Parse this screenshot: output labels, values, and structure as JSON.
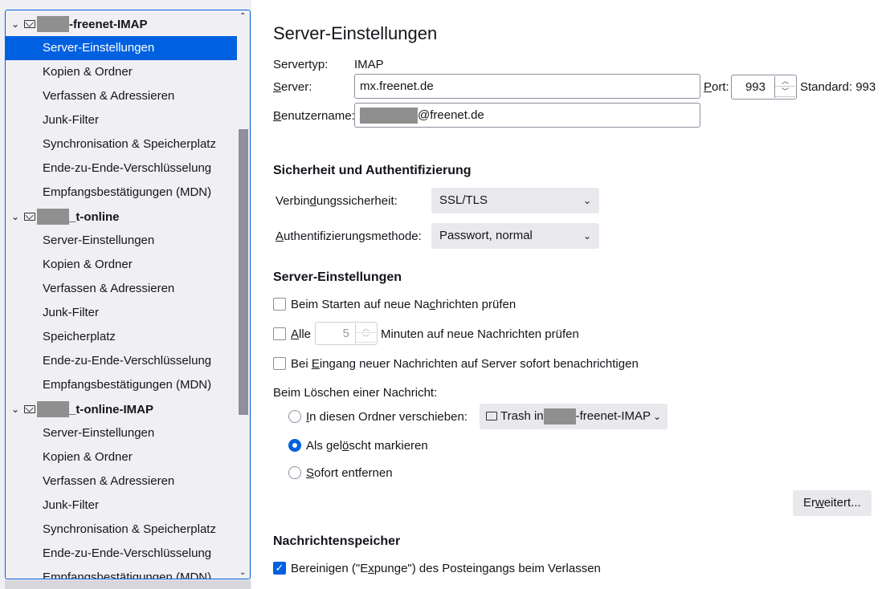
{
  "tree": {
    "accounts": [
      {
        "name_suffix": "-freenet-IMAP",
        "items": [
          "Server-Einstellungen",
          "Kopien & Ordner",
          "Verfassen & Adressieren",
          "Junk-Filter",
          "Synchronisation & Speicherplatz",
          "Ende-zu-Ende-Verschlüsselung",
          "Empfangsbestätigungen (MDN)"
        ]
      },
      {
        "name_suffix": "_t-online",
        "items": [
          "Server-Einstellungen",
          "Kopien & Ordner",
          "Verfassen & Adressieren",
          "Junk-Filter",
          "Speicherplatz",
          "Ende-zu-Ende-Verschlüsselung",
          "Empfangsbestätigungen (MDN)"
        ]
      },
      {
        "name_suffix": "_t-online-IMAP",
        "items": [
          "Server-Einstellungen",
          "Kopien & Ordner",
          "Verfassen & Adressieren",
          "Junk-Filter",
          "Synchronisation & Speicherplatz",
          "Ende-zu-Ende-Verschlüsselung",
          "Empfangsbestätigungen (MDN)"
        ]
      }
    ],
    "selected": "Server-Einstellungen"
  },
  "page": {
    "title": "Server-Einstellungen",
    "servertyp_label": "Servertyp:",
    "servertyp_value": "IMAP",
    "server_label": "Server:",
    "server_value": "mx.freenet.de",
    "port_label": "Port:",
    "port_value": "993",
    "standard_text": "Standard: 993",
    "username_label": "Benutzername:",
    "username_suffix": "@freenet.de"
  },
  "security": {
    "heading": "Sicherheit und Authentifizierung",
    "connection_label": "Verbindungssicherheit:",
    "connection_value": "SSL/TLS",
    "auth_label": "Authentifizierungsmethode:",
    "auth_value": "Passwort, normal"
  },
  "server_settings": {
    "heading": "Server-Einstellungen",
    "check_on_start": "Beim Starten auf neue Nachrichten prüfen",
    "check_every_prefix": "Alle",
    "check_every_value": "5",
    "check_every_suffix": "Minuten auf neue Nachrichten prüfen",
    "notify_immediately": "Bei Eingang neuer Nachrichten auf Server sofort benachrichtigen",
    "delete_label": "Beim Löschen einer Nachricht:",
    "move_to_folder": "In diesen Ordner verschieben:",
    "folder_prefix": "Trash in",
    "folder_suffix": "-freenet-IMAP",
    "mark_deleted": "Als gelöscht markieren",
    "remove_immediately": "Sofort entfernen",
    "advanced_button": "Erweitert..."
  },
  "storage": {
    "heading": "Nachrichtenspeicher",
    "expunge": "Bereinigen (\"Expunge\") des Posteingangs beim Verlassen"
  },
  "colors": {
    "accent": "#0061e0",
    "redaction": "#8f8f8f"
  },
  "icons": [
    "chevron-down-icon",
    "mail-icon",
    "folder-icon",
    "spin-up-icon",
    "spin-down-icon",
    "checkmark-icon"
  ]
}
